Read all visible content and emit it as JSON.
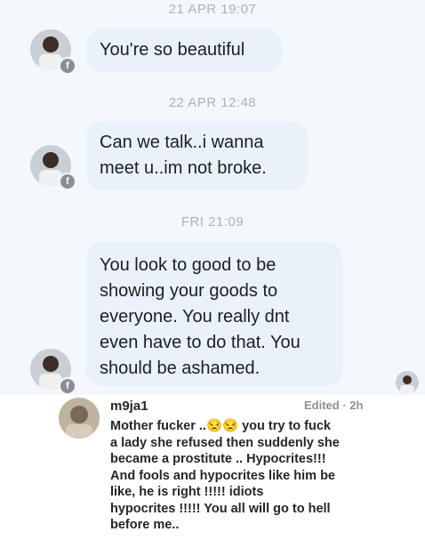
{
  "conversation": {
    "messages": [
      {
        "timestamp": "21 APR 19:07",
        "lines": [
          "You're so beautiful"
        ]
      },
      {
        "timestamp": "22 APR 12:48",
        "lines": [
          "Can we talk..i wanna",
          "meet u..im not broke."
        ]
      },
      {
        "timestamp": "FRI 21:09",
        "lines": [
          "You look to good to be",
          "showing your goods to",
          "everyone. You really dnt",
          "even have to do that. You",
          "should be ashamed."
        ]
      }
    ],
    "sender_badge_icon": "facebook-icon"
  },
  "comment": {
    "username": "m9ja1",
    "edited_label": "Edited · 2h",
    "lines": [
      "Mother fucker ..😒😒 you try to fuck",
      "a lady she refused then suddenly she",
      "became a prostitute .. Hypocrites!!!",
      "And fools and hypocrites like him be",
      "like,  he is right !!!!! idiots",
      "hypocrites !!!!! You all will go to hell",
      "before me.."
    ]
  }
}
